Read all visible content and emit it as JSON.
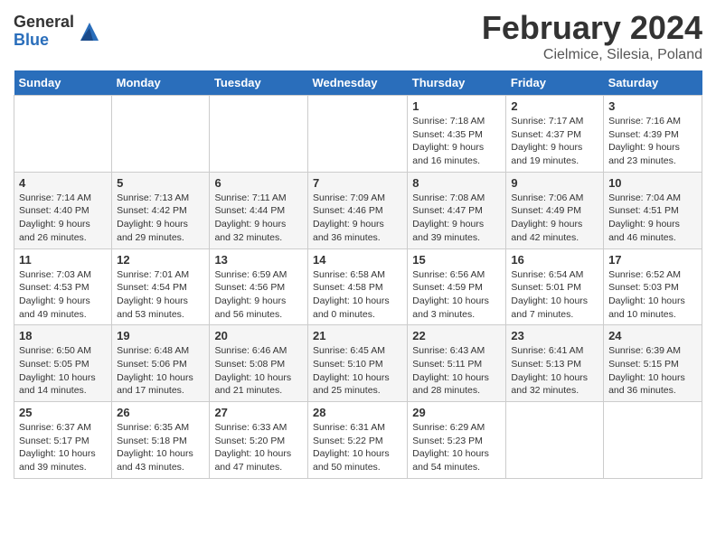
{
  "header": {
    "logo_general": "General",
    "logo_blue": "Blue",
    "month_title": "February 2024",
    "location": "Cielmice, Silesia, Poland"
  },
  "days_of_week": [
    "Sunday",
    "Monday",
    "Tuesday",
    "Wednesday",
    "Thursday",
    "Friday",
    "Saturday"
  ],
  "weeks": [
    [
      {
        "day": "",
        "info": ""
      },
      {
        "day": "",
        "info": ""
      },
      {
        "day": "",
        "info": ""
      },
      {
        "day": "",
        "info": ""
      },
      {
        "day": "1",
        "info": "Sunrise: 7:18 AM\nSunset: 4:35 PM\nDaylight: 9 hours\nand 16 minutes."
      },
      {
        "day": "2",
        "info": "Sunrise: 7:17 AM\nSunset: 4:37 PM\nDaylight: 9 hours\nand 19 minutes."
      },
      {
        "day": "3",
        "info": "Sunrise: 7:16 AM\nSunset: 4:39 PM\nDaylight: 9 hours\nand 23 minutes."
      }
    ],
    [
      {
        "day": "4",
        "info": "Sunrise: 7:14 AM\nSunset: 4:40 PM\nDaylight: 9 hours\nand 26 minutes."
      },
      {
        "day": "5",
        "info": "Sunrise: 7:13 AM\nSunset: 4:42 PM\nDaylight: 9 hours\nand 29 minutes."
      },
      {
        "day": "6",
        "info": "Sunrise: 7:11 AM\nSunset: 4:44 PM\nDaylight: 9 hours\nand 32 minutes."
      },
      {
        "day": "7",
        "info": "Sunrise: 7:09 AM\nSunset: 4:46 PM\nDaylight: 9 hours\nand 36 minutes."
      },
      {
        "day": "8",
        "info": "Sunrise: 7:08 AM\nSunset: 4:47 PM\nDaylight: 9 hours\nand 39 minutes."
      },
      {
        "day": "9",
        "info": "Sunrise: 7:06 AM\nSunset: 4:49 PM\nDaylight: 9 hours\nand 42 minutes."
      },
      {
        "day": "10",
        "info": "Sunrise: 7:04 AM\nSunset: 4:51 PM\nDaylight: 9 hours\nand 46 minutes."
      }
    ],
    [
      {
        "day": "11",
        "info": "Sunrise: 7:03 AM\nSunset: 4:53 PM\nDaylight: 9 hours\nand 49 minutes."
      },
      {
        "day": "12",
        "info": "Sunrise: 7:01 AM\nSunset: 4:54 PM\nDaylight: 9 hours\nand 53 minutes."
      },
      {
        "day": "13",
        "info": "Sunrise: 6:59 AM\nSunset: 4:56 PM\nDaylight: 9 hours\nand 56 minutes."
      },
      {
        "day": "14",
        "info": "Sunrise: 6:58 AM\nSunset: 4:58 PM\nDaylight: 10 hours\nand 0 minutes."
      },
      {
        "day": "15",
        "info": "Sunrise: 6:56 AM\nSunset: 4:59 PM\nDaylight: 10 hours\nand 3 minutes."
      },
      {
        "day": "16",
        "info": "Sunrise: 6:54 AM\nSunset: 5:01 PM\nDaylight: 10 hours\nand 7 minutes."
      },
      {
        "day": "17",
        "info": "Sunrise: 6:52 AM\nSunset: 5:03 PM\nDaylight: 10 hours\nand 10 minutes."
      }
    ],
    [
      {
        "day": "18",
        "info": "Sunrise: 6:50 AM\nSunset: 5:05 PM\nDaylight: 10 hours\nand 14 minutes."
      },
      {
        "day": "19",
        "info": "Sunrise: 6:48 AM\nSunset: 5:06 PM\nDaylight: 10 hours\nand 17 minutes."
      },
      {
        "day": "20",
        "info": "Sunrise: 6:46 AM\nSunset: 5:08 PM\nDaylight: 10 hours\nand 21 minutes."
      },
      {
        "day": "21",
        "info": "Sunrise: 6:45 AM\nSunset: 5:10 PM\nDaylight: 10 hours\nand 25 minutes."
      },
      {
        "day": "22",
        "info": "Sunrise: 6:43 AM\nSunset: 5:11 PM\nDaylight: 10 hours\nand 28 minutes."
      },
      {
        "day": "23",
        "info": "Sunrise: 6:41 AM\nSunset: 5:13 PM\nDaylight: 10 hours\nand 32 minutes."
      },
      {
        "day": "24",
        "info": "Sunrise: 6:39 AM\nSunset: 5:15 PM\nDaylight: 10 hours\nand 36 minutes."
      }
    ],
    [
      {
        "day": "25",
        "info": "Sunrise: 6:37 AM\nSunset: 5:17 PM\nDaylight: 10 hours\nand 39 minutes."
      },
      {
        "day": "26",
        "info": "Sunrise: 6:35 AM\nSunset: 5:18 PM\nDaylight: 10 hours\nand 43 minutes."
      },
      {
        "day": "27",
        "info": "Sunrise: 6:33 AM\nSunset: 5:20 PM\nDaylight: 10 hours\nand 47 minutes."
      },
      {
        "day": "28",
        "info": "Sunrise: 6:31 AM\nSunset: 5:22 PM\nDaylight: 10 hours\nand 50 minutes."
      },
      {
        "day": "29",
        "info": "Sunrise: 6:29 AM\nSunset: 5:23 PM\nDaylight: 10 hours\nand 54 minutes."
      },
      {
        "day": "",
        "info": ""
      },
      {
        "day": "",
        "info": ""
      }
    ]
  ]
}
